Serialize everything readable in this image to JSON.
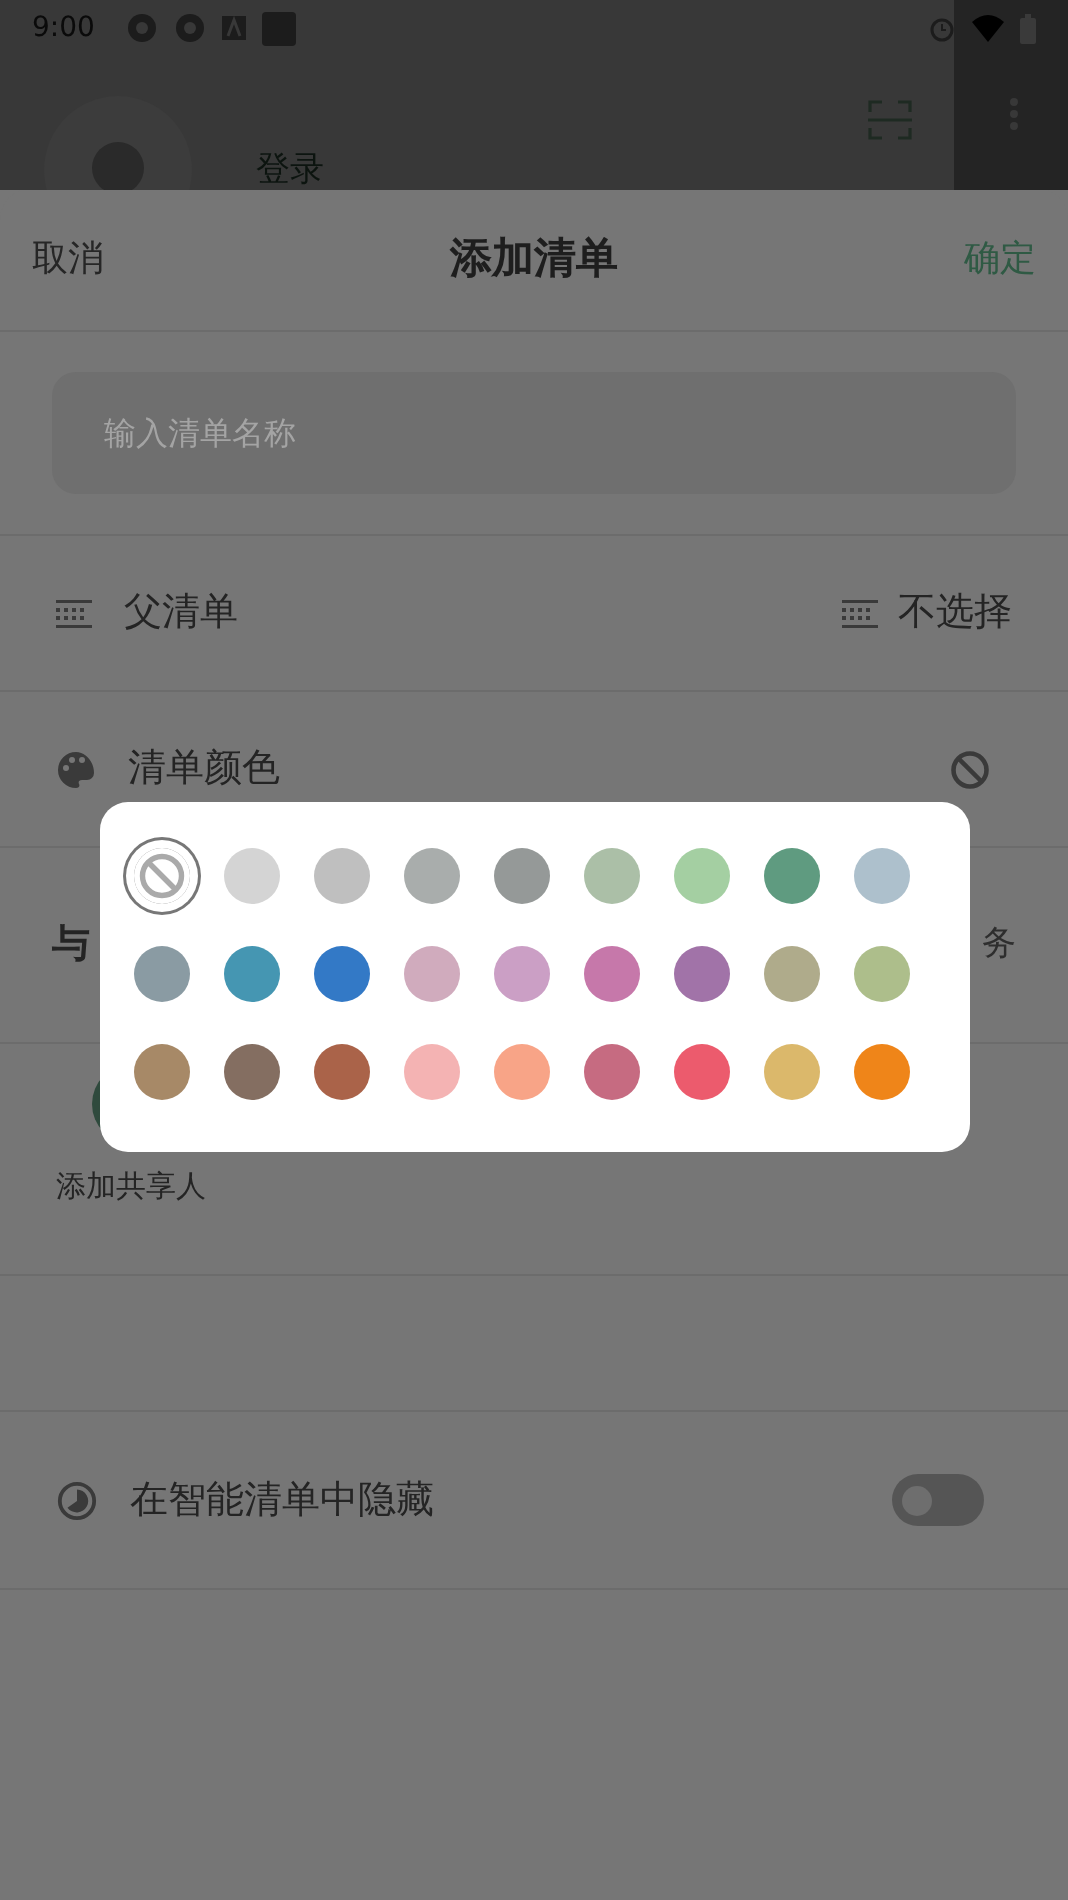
{
  "status_bar": {
    "time": "9:00"
  },
  "background": {
    "login_label": "登录"
  },
  "sheet": {
    "cancel": "取消",
    "title": "添加清单",
    "confirm": "确定",
    "name_field": {
      "placeholder": "输入清单名称"
    },
    "parent_row": {
      "label": "父清单",
      "value": "不选择"
    },
    "color_row": {
      "label": "清单颜色"
    },
    "share_section": {
      "label": "与",
      "right_text": "务",
      "add_label": "添加共享人"
    },
    "hide_row": {
      "label": "在智能清单中隐藏",
      "on": false
    }
  },
  "color_picker": {
    "swatches": [
      {
        "kind": "none",
        "selected": true
      },
      {
        "kind": "color",
        "color": "#d4d4d4",
        "selected": false
      },
      {
        "kind": "color",
        "color": "#bfbfbf",
        "selected": false
      },
      {
        "kind": "color",
        "color": "#a9adac",
        "selected": false
      },
      {
        "kind": "color",
        "color": "#959998",
        "selected": false
      },
      {
        "kind": "color",
        "color": "#abbfa7",
        "selected": false
      },
      {
        "kind": "color",
        "color": "#a4cfa2",
        "selected": false
      },
      {
        "kind": "color",
        "color": "#5f9b80",
        "selected": false
      },
      {
        "kind": "color",
        "color": "#adc0cc",
        "selected": false
      },
      {
        "kind": "color",
        "color": "#8a9ba3",
        "selected": false
      },
      {
        "kind": "color",
        "color": "#4596b2",
        "selected": false
      },
      {
        "kind": "color",
        "color": "#3379c6",
        "selected": false
      },
      {
        "kind": "color",
        "color": "#d0abbd",
        "selected": false
      },
      {
        "kind": "color",
        "color": "#cb9fc5",
        "selected": false
      },
      {
        "kind": "color",
        "color": "#c678aa",
        "selected": false
      },
      {
        "kind": "color",
        "color": "#a173a8",
        "selected": false
      },
      {
        "kind": "color",
        "color": "#afab8b",
        "selected": false
      },
      {
        "kind": "color",
        "color": "#adbe8b",
        "selected": false
      },
      {
        "kind": "color",
        "color": "#a78967",
        "selected": false
      },
      {
        "kind": "color",
        "color": "#846e61",
        "selected": false
      },
      {
        "kind": "color",
        "color": "#aa6349",
        "selected": false
      },
      {
        "kind": "color",
        "color": "#f4b3b3",
        "selected": false
      },
      {
        "kind": "color",
        "color": "#f8a487",
        "selected": false
      },
      {
        "kind": "color",
        "color": "#c66b81",
        "selected": false
      },
      {
        "kind": "color",
        "color": "#ec5b6d",
        "selected": false
      },
      {
        "kind": "color",
        "color": "#dbb86b",
        "selected": false
      },
      {
        "kind": "color",
        "color": "#ef8519",
        "selected": false
      }
    ]
  }
}
